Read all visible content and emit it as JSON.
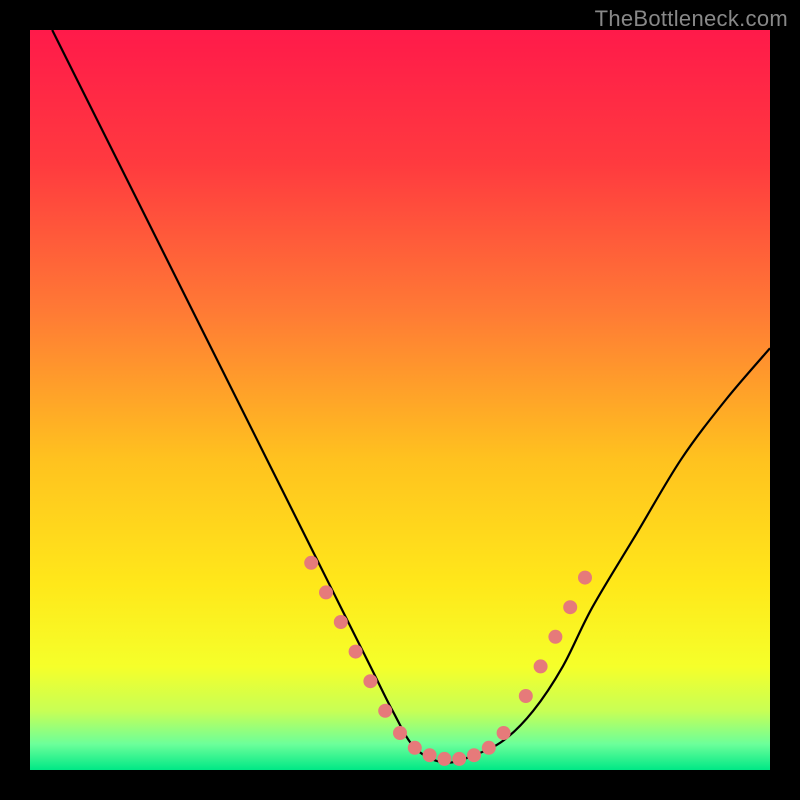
{
  "watermark": "TheBottleneck.com",
  "chart_data": {
    "type": "line",
    "title": "",
    "xlabel": "",
    "ylabel": "",
    "xlim": [
      0,
      100
    ],
    "ylim": [
      0,
      100
    ],
    "grid": false,
    "legend": false,
    "gradient_stops": [
      {
        "offset": 0.0,
        "color": "#ff1a4a"
      },
      {
        "offset": 0.18,
        "color": "#ff3a3f"
      },
      {
        "offset": 0.38,
        "color": "#ff7a35"
      },
      {
        "offset": 0.58,
        "color": "#ffc21f"
      },
      {
        "offset": 0.75,
        "color": "#ffe81a"
      },
      {
        "offset": 0.86,
        "color": "#f5ff2a"
      },
      {
        "offset": 0.92,
        "color": "#c8ff55"
      },
      {
        "offset": 0.965,
        "color": "#6cff9a"
      },
      {
        "offset": 1.0,
        "color": "#00e886"
      }
    ],
    "series": [
      {
        "name": "bottleneck-curve",
        "color": "#000000",
        "x": [
          3,
          8,
          14,
          20,
          26,
          32,
          38,
          42,
          46,
          49,
          52,
          56,
          60,
          64,
          68,
          72,
          76,
          82,
          88,
          94,
          100
        ],
        "y": [
          100,
          90,
          78,
          66,
          54,
          42,
          30,
          22,
          14,
          8,
          3,
          1,
          2,
          4,
          8,
          14,
          22,
          32,
          42,
          50,
          57
        ]
      }
    ],
    "scatter": [
      {
        "name": "highlight-dots",
        "color": "#e67a7a",
        "radius": 7,
        "points": [
          {
            "x": 38,
            "y": 28
          },
          {
            "x": 40,
            "y": 24
          },
          {
            "x": 42,
            "y": 20
          },
          {
            "x": 44,
            "y": 16
          },
          {
            "x": 46,
            "y": 12
          },
          {
            "x": 48,
            "y": 8
          },
          {
            "x": 50,
            "y": 5
          },
          {
            "x": 52,
            "y": 3
          },
          {
            "x": 54,
            "y": 2
          },
          {
            "x": 56,
            "y": 1.5
          },
          {
            "x": 58,
            "y": 1.5
          },
          {
            "x": 60,
            "y": 2
          },
          {
            "x": 62,
            "y": 3
          },
          {
            "x": 64,
            "y": 5
          },
          {
            "x": 67,
            "y": 10
          },
          {
            "x": 69,
            "y": 14
          },
          {
            "x": 71,
            "y": 18
          },
          {
            "x": 73,
            "y": 22
          },
          {
            "x": 75,
            "y": 26
          }
        ]
      }
    ]
  }
}
